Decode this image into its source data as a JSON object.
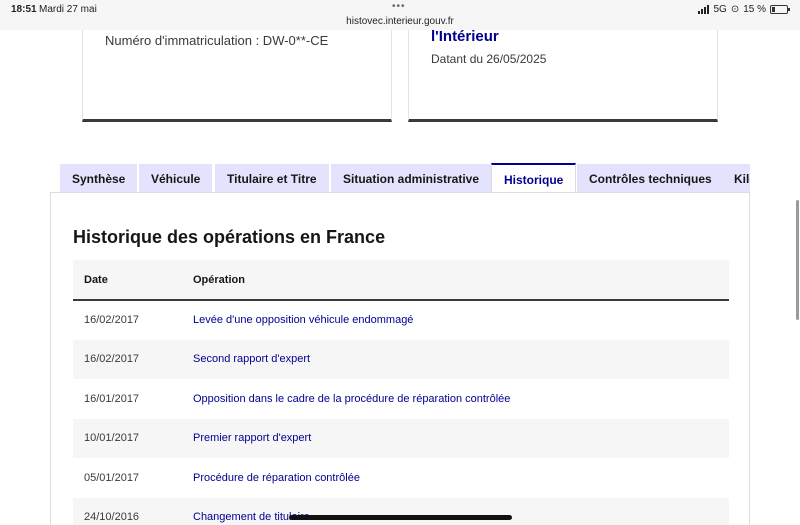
{
  "status_bar": {
    "time": "18:51",
    "date": "Mardi 27 mai",
    "url": "histovec.interieur.gouv.fr",
    "network": "5G",
    "battery": "15 %"
  },
  "cards": {
    "left": {
      "plate": "Numéro d'immatriculation : DW-0**-CE"
    },
    "right": {
      "heading": "l'Intérieur",
      "dated": "Datant du 26/05/2025"
    }
  },
  "tabs": [
    {
      "label": "Synthèse"
    },
    {
      "label": "Véhicule"
    },
    {
      "label": "Titulaire et Titre"
    },
    {
      "label": "Situation administrative"
    },
    {
      "label": "Historique"
    },
    {
      "label": "Contrôles techniques"
    },
    {
      "label": "Kilo"
    }
  ],
  "active_tab": "Historique",
  "history": {
    "title": "Historique des opérations en France",
    "columns": {
      "date": "Date",
      "operation": "Opération"
    },
    "rows": [
      {
        "date": "16/02/2017",
        "operation": "Levée d'une opposition véhicule endommagé"
      },
      {
        "date": "16/02/2017",
        "operation": "Second rapport d'expert"
      },
      {
        "date": "16/01/2017",
        "operation": "Opposition dans le cadre de la procédure de réparation contrôlée"
      },
      {
        "date": "10/01/2017",
        "operation": "Premier rapport d'expert"
      },
      {
        "date": "05/01/2017",
        "operation": "Procédure de réparation contrôlée"
      },
      {
        "date": "24/10/2016",
        "operation": "Changement de titulaire"
      }
    ]
  },
  "colors": {
    "accent": "#000091",
    "tab_background": "#e3e3fd",
    "stripe": "#f6f6f6"
  }
}
